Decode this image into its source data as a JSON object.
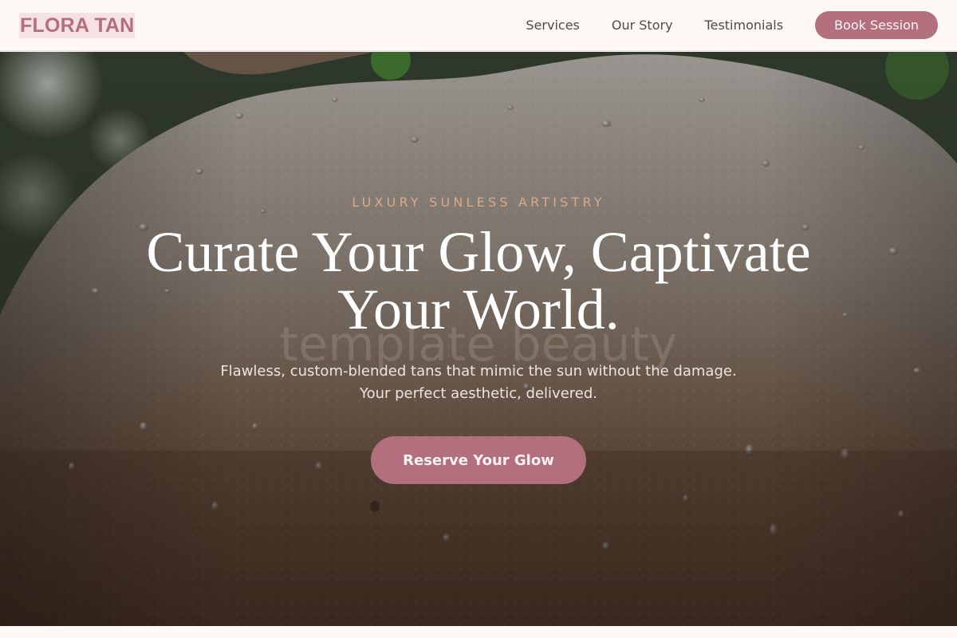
{
  "brand": {
    "name": "FLORA TAN"
  },
  "nav": {
    "links": [
      "Services",
      "Our Story",
      "Testimonials"
    ],
    "cta_label": "Book Session"
  },
  "hero": {
    "eyebrow": "LUXURY SUNLESS ARTISTRY",
    "headline": "Curate Your Glow, Captivate Your World.",
    "watermark": "template beauty",
    "subtext_line1": "Flawless, custom-blended tans that mimic the sun without the damage.",
    "subtext_line2": "Your perfect aesthetic, delivered.",
    "cta_label": "Reserve Your Glow",
    "background_image": "close-up of a water-beaded shoulder with blurred green foliage"
  },
  "colors": {
    "accent": "#b46f7c",
    "eyebrow": "#d9a98d",
    "nav_background": "#fdf8f4"
  }
}
